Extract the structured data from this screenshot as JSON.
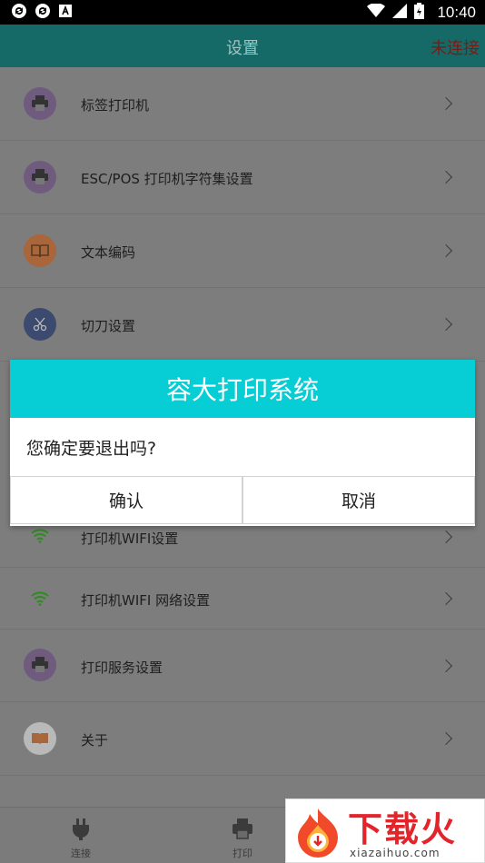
{
  "status_bar": {
    "time": "10:40",
    "icons": [
      "sync-icon",
      "sync-icon",
      "notification-a-icon",
      "wifi-icon",
      "signal-icon",
      "battery-icon"
    ]
  },
  "app_bar": {
    "title": "设置",
    "status": "未连接"
  },
  "settings": {
    "items": [
      {
        "label": "标签打印机",
        "icon": "printer-icon"
      },
      {
        "label": "ESC/POS 打印机字符集设置",
        "icon": "printer-icon"
      },
      {
        "label": "文本编码",
        "icon": "book-icon"
      },
      {
        "label": "切刀设置",
        "icon": "scissors-icon"
      },
      {
        "label": "打印机WIFI设置",
        "icon": "wifi-icon"
      },
      {
        "label": "打印机WIFI 网络设置",
        "icon": "wifi-icon"
      },
      {
        "label": "打印服务设置",
        "icon": "printer-icon"
      },
      {
        "label": "关于",
        "icon": "book-icon"
      }
    ]
  },
  "dialog": {
    "title": "容大打印系统",
    "message": "您确定要退出吗?",
    "confirm_label": "确认",
    "cancel_label": "取消"
  },
  "bottom_nav": {
    "items": [
      {
        "label": "连接",
        "icon": "plug-icon"
      },
      {
        "label": "打印",
        "icon": "printer-icon"
      }
    ]
  },
  "watermark": {
    "brand": "下载火",
    "domain": "xiazaihuo.com"
  },
  "colors": {
    "app_bar": "#156a67",
    "dialog_header": "#07cdd4",
    "status_red": "#7a1b14",
    "icon_purple": "#6e5b7d",
    "icon_orange": "#a8663a",
    "icon_blue": "#3b4a6e",
    "icon_gray": "#b9b9b9",
    "wifi_green": "#2f8a22"
  }
}
